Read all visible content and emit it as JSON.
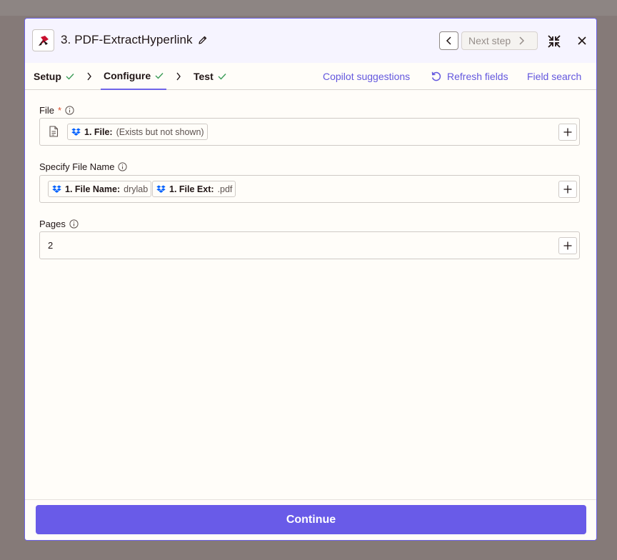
{
  "step": {
    "title": "3. PDF-ExtractHyperlink",
    "next_step_label": "Next step"
  },
  "tabs": [
    {
      "label": "Setup"
    },
    {
      "label": "Configure"
    },
    {
      "label": "Test"
    }
  ],
  "actions": {
    "copilot": "Copilot suggestions",
    "refresh": "Refresh fields",
    "field_search": "Field search"
  },
  "fields": {
    "file": {
      "label": "File",
      "required_mark": "*",
      "pill": {
        "key": "1. File:",
        "value": "(Exists but not shown)"
      }
    },
    "file_name": {
      "label": "Specify File Name",
      "pills": [
        {
          "key": "1. File Name:",
          "value": "drylab"
        },
        {
          "key": "1. File Ext:",
          "value": ".pdf"
        }
      ]
    },
    "pages": {
      "label": "Pages",
      "value": "2"
    }
  },
  "footer": {
    "continue_label": "Continue"
  },
  "colors": {
    "accent": "#695be8",
    "check": "#3a9b56",
    "dropbox": "#0061fe",
    "required": "#dc4d2b"
  },
  "icons": [
    "app-logo-icon",
    "edit-pencil-icon",
    "chevron-left-icon",
    "chevron-right-icon",
    "collapse-icon",
    "close-icon",
    "check-icon",
    "refresh-icon",
    "info-icon",
    "document-icon",
    "dropbox-icon",
    "plus-icon"
  ]
}
